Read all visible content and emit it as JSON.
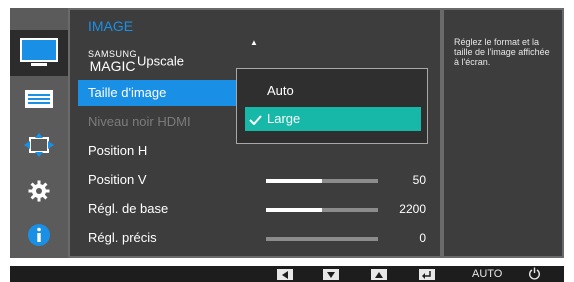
{
  "menu": {
    "title": "IMAGE",
    "items": [
      {
        "label_prefix_top": "SAMSUNG",
        "label_prefix_bottom": "MAGIC",
        "label": "Upscale"
      },
      {
        "label": "Taille d'image"
      },
      {
        "label": "Niveau noir HDMI"
      },
      {
        "label": "Position H"
      },
      {
        "label": "Position V",
        "value": "50",
        "fill_fraction": 0.5
      },
      {
        "label": "Régl. de base",
        "value": "2200",
        "fill_fraction": 0.5
      },
      {
        "label": "Régl. précis",
        "value": "0",
        "fill_fraction": 0.0
      }
    ]
  },
  "dropdown": {
    "options": [
      "Auto",
      "Large"
    ],
    "selected": "Large"
  },
  "help": {
    "text": "Réglez le format et la taille de l'image affichée à l'écran."
  },
  "bottombar": {
    "auto_label": "AUTO"
  },
  "icons": [
    "picture-icon",
    "onscreen-display-icon",
    "position-icon",
    "gear-icon",
    "info-icon"
  ],
  "colors": {
    "accent": "#1a8fe6",
    "selection": "#17b8a8",
    "panel": "#3d3d3d"
  }
}
